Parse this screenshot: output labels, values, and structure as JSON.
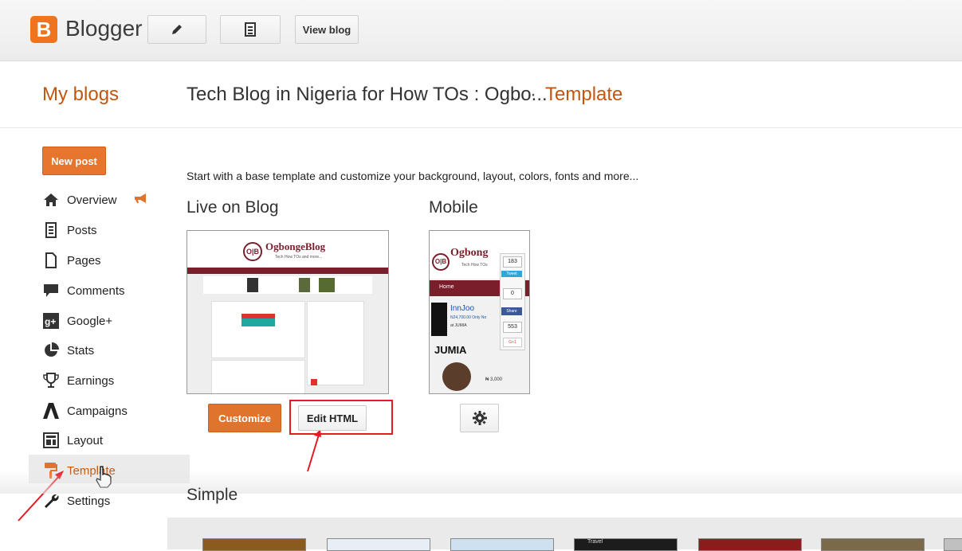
{
  "topbar": {
    "brand": "Blogger",
    "logo_letter": "B",
    "view_blog_label": "View blog"
  },
  "header": {
    "my_blogs": "My blogs",
    "blog_title": "Tech Blog in Nigeria for How TOs : Ogbo...",
    "separator": "·",
    "section": "Template"
  },
  "sidebar": {
    "new_post_label": "New post",
    "items": [
      {
        "label": "Overview",
        "icon": "home-icon"
      },
      {
        "label": "Posts",
        "icon": "posts-icon"
      },
      {
        "label": "Pages",
        "icon": "pages-icon"
      },
      {
        "label": "Comments",
        "icon": "comments-icon"
      },
      {
        "label": "Google+",
        "icon": "google-plus-icon"
      },
      {
        "label": "Stats",
        "icon": "stats-icon"
      },
      {
        "label": "Earnings",
        "icon": "trophy-icon"
      },
      {
        "label": "Campaigns",
        "icon": "campaigns-icon"
      },
      {
        "label": "Layout",
        "icon": "layout-icon"
      },
      {
        "label": "Template",
        "icon": "template-icon"
      },
      {
        "label": "Settings",
        "icon": "wrench-icon"
      }
    ]
  },
  "main": {
    "intro": "Start with a base template and customize your background, layout, colors, fonts and more...",
    "live_heading": "Live on Blog",
    "mobile_heading": "Mobile",
    "simple_heading": "Simple",
    "customize_label": "Customize",
    "edit_html_label": "Edit HTML",
    "live_preview": {
      "blog_name": "OgbongeBlog",
      "tagline": "Tech How TOs and more..."
    },
    "mobile_preview": {
      "blog_name": "Ogbong",
      "tagline": "Tech How TOs",
      "home": "Home",
      "item_title": "InnJoo",
      "item_price": "N24,700.00 Only No",
      "item_seller": "at JUMIA",
      "jumia": "JUMIA",
      "price2": "₦ 3,000",
      "counts": [
        "183",
        "0",
        "553"
      ],
      "share_label": "Share",
      "g_label": "G+1",
      "tweet_label": "Tweet"
    },
    "simple_thumb_label": "Travel"
  },
  "colors": {
    "accent": "#e1742c",
    "link_orange": "#c1570f",
    "annotation_red": "#e31b23"
  }
}
